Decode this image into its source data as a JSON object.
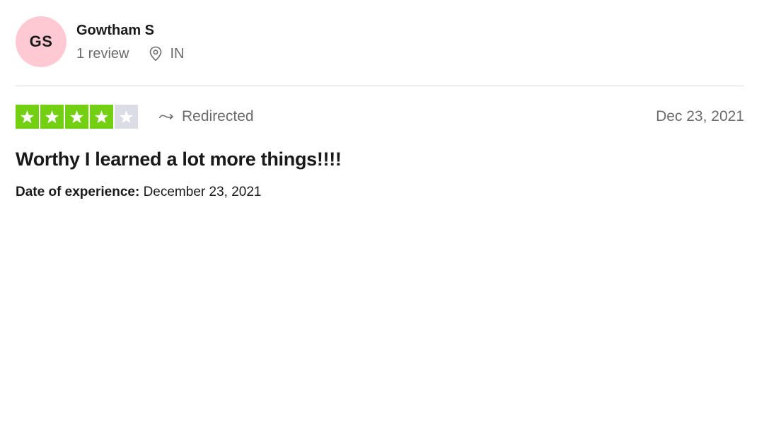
{
  "consumer": {
    "initials": "GS",
    "name": "Gowtham S",
    "review_count": "1 review",
    "country": "IN",
    "avatar_color": "#ffc9d4",
    "pin_icon": "location-pin-icon"
  },
  "review": {
    "rating": 4,
    "max_rating": 5,
    "star_color_filled": "#73cf11",
    "star_color_empty": "#dcdce6",
    "star_icon": "star-icon",
    "redirect_icon": "redirect-arrow-icon",
    "redirect_label": "Redirected",
    "date": "Dec 23, 2021",
    "title": "Worthy I learned a lot more things!!!!",
    "experience_label": "Date of experience:",
    "experience_date": "December 23, 2021"
  }
}
